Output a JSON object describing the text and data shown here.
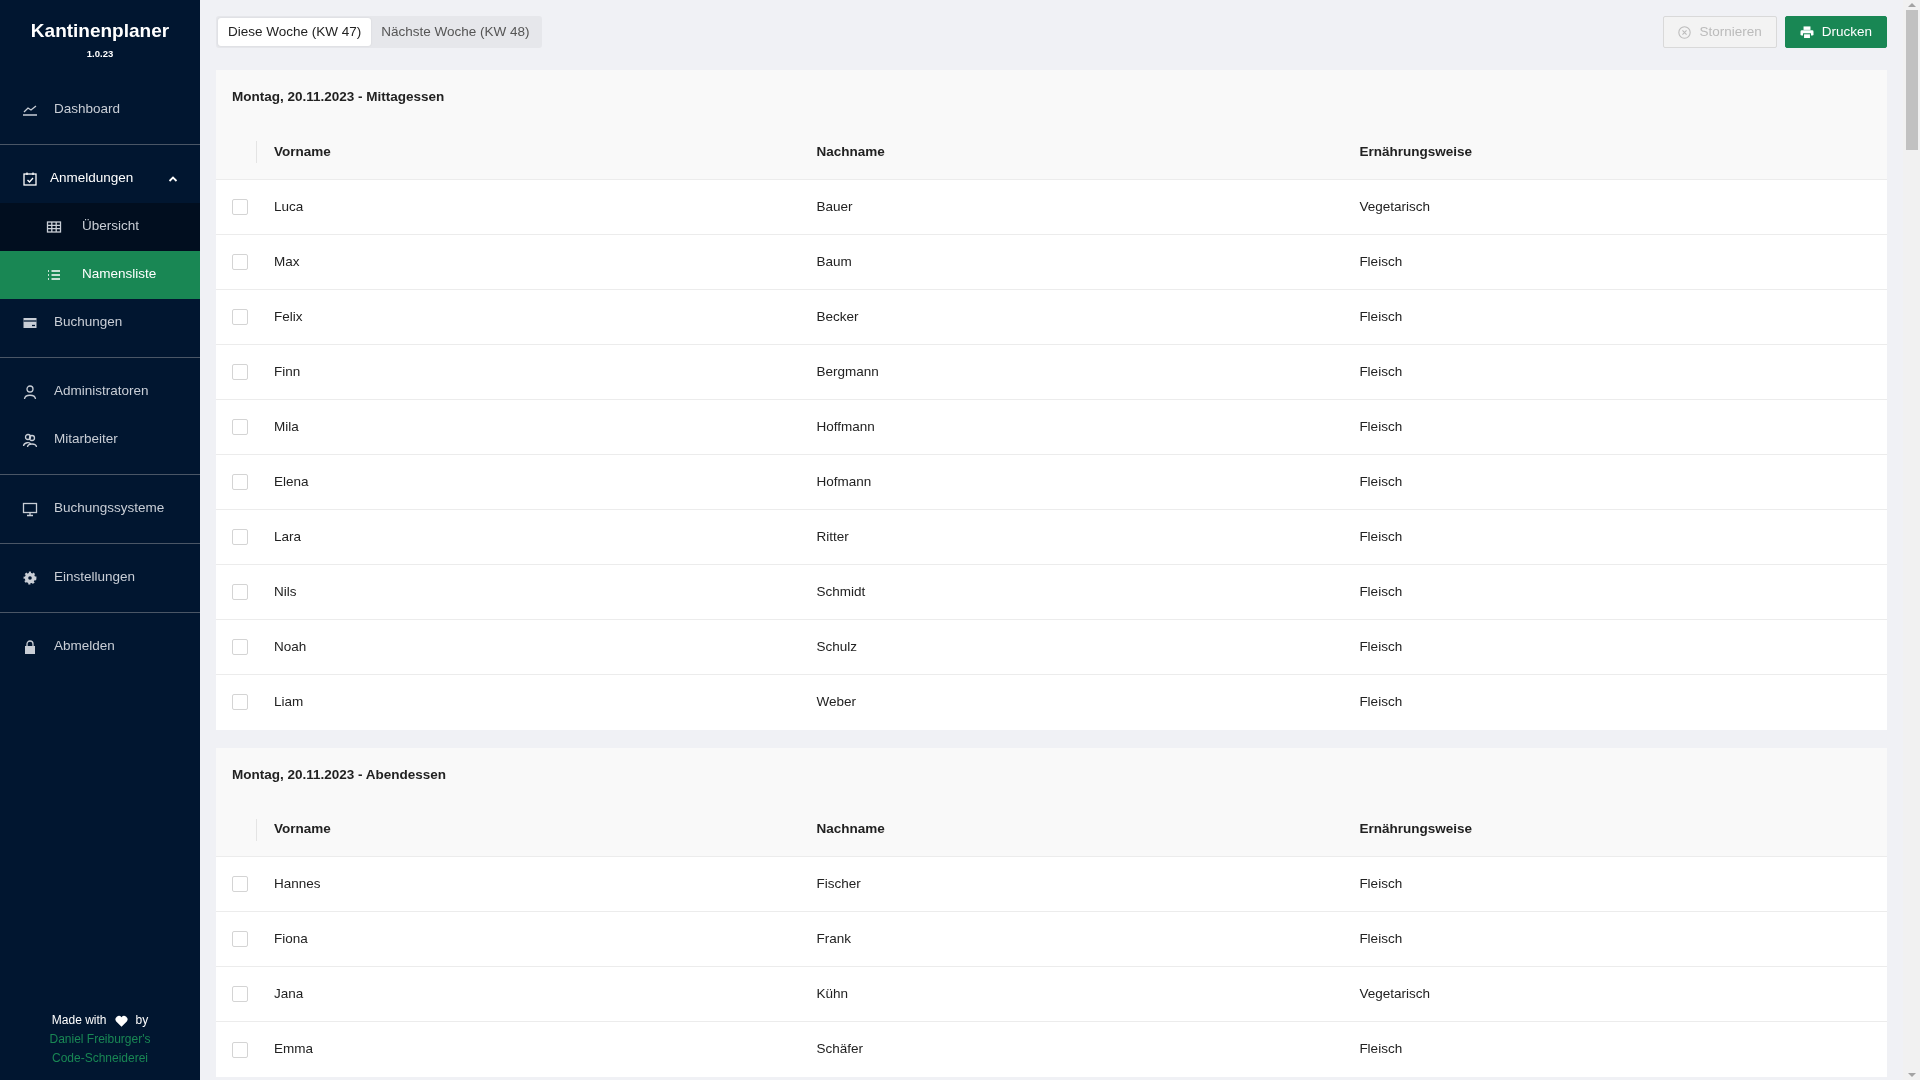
{
  "app": {
    "title": "Kantinenplaner",
    "version": "1.0.23"
  },
  "sidebar": {
    "groups": [
      [
        {
          "label": "Dashboard",
          "kind": "chart",
          "selected": false
        }
      ],
      [
        {
          "label": "Anmeldungen",
          "kind": "calendar",
          "selected": false,
          "expanded": true,
          "children": [
            {
              "label": "Übersicht",
              "kind": "grid",
              "selected": false
            },
            {
              "label": "Namensliste",
              "kind": "list",
              "selected": true
            }
          ]
        },
        {
          "label": "Buchungen",
          "kind": "card",
          "selected": false
        }
      ],
      [
        {
          "label": "Administratoren",
          "kind": "person",
          "selected": false
        },
        {
          "label": "Mitarbeiter",
          "kind": "people",
          "selected": false
        }
      ],
      [
        {
          "label": "Buchungssysteme",
          "kind": "monitor",
          "selected": false
        }
      ],
      [
        {
          "label": "Einstellungen",
          "kind": "gear",
          "selected": false
        }
      ],
      [
        {
          "label": "Abmelden",
          "kind": "lock",
          "selected": false
        }
      ]
    ],
    "footer": {
      "made_with": "Made with",
      "by": "by",
      "author_line_1": "Daniel Freiburger's",
      "author_line_2": "Code-Schneiderei"
    }
  },
  "week_tabs": [
    {
      "label": "Diese Woche (KW 47)",
      "selected": true
    },
    {
      "label": "Nächste Woche (KW 48)",
      "selected": false
    }
  ],
  "actions": [
    {
      "label": "Stornieren",
      "kind": "cancel",
      "disabled": true
    },
    {
      "label": "Drucken",
      "kind": "print",
      "disabled": false
    }
  ],
  "sections": [
    {
      "title": "Montag, 20.11.2023 - Mittagessen",
      "columns": [
        "Vorname",
        "Nachname",
        "Ernährungsweise"
      ],
      "rows": [
        {
          "checked": false,
          "cells": [
            "Luca",
            "Bauer",
            "Vegetarisch"
          ]
        },
        {
          "checked": false,
          "cells": [
            "Max",
            "Baum",
            "Fleisch"
          ]
        },
        {
          "checked": false,
          "cells": [
            "Felix",
            "Becker",
            "Fleisch"
          ]
        },
        {
          "checked": false,
          "cells": [
            "Finn",
            "Bergmann",
            "Fleisch"
          ]
        },
        {
          "checked": false,
          "cells": [
            "Mila",
            "Hoffmann",
            "Fleisch"
          ]
        },
        {
          "checked": false,
          "cells": [
            "Elena",
            "Hofmann",
            "Fleisch"
          ]
        },
        {
          "checked": false,
          "cells": [
            "Lara",
            "Ritter",
            "Fleisch"
          ]
        },
        {
          "checked": false,
          "cells": [
            "Nils",
            "Schmidt",
            "Fleisch"
          ]
        },
        {
          "checked": false,
          "cells": [
            "Noah",
            "Schulz",
            "Fleisch"
          ]
        },
        {
          "checked": false,
          "cells": [
            "Liam",
            "Weber",
            "Fleisch"
          ]
        }
      ]
    },
    {
      "title": "Montag, 20.11.2023 - Abendessen",
      "columns": [
        "Vorname",
        "Nachname",
        "Ernährungsweise"
      ],
      "rows": [
        {
          "checked": false,
          "cells": [
            "Hannes",
            "Fischer",
            "Fleisch"
          ]
        },
        {
          "checked": false,
          "cells": [
            "Fiona",
            "Frank",
            "Fleisch"
          ]
        },
        {
          "checked": false,
          "cells": [
            "Jana",
            "Kühn",
            "Vegetarisch"
          ]
        },
        {
          "checked": false,
          "cells": [
            "Emma",
            "Schäfer",
            "Fleisch"
          ]
        }
      ]
    }
  ]
}
